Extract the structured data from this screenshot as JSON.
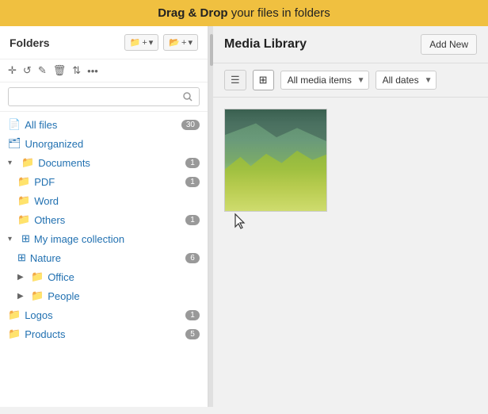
{
  "banner": {
    "text_bold": "Drag & Drop",
    "text_rest": " your files in folders"
  },
  "left_panel": {
    "folders_label": "Folders",
    "btn_new_folder": "+ ▾",
    "btn_new_subfolder": "+ ▾",
    "toolbar_icons": [
      "✛",
      "↺",
      "✎",
      "🗑",
      "↑↓",
      "…"
    ],
    "search_placeholder": "",
    "tree": [
      {
        "id": "all-files",
        "label": "All files",
        "icon": "file",
        "indent": 0,
        "badge": "30",
        "chevron": ""
      },
      {
        "id": "unorganized",
        "label": "Unorganized",
        "icon": "folder-outline",
        "indent": 0,
        "badge": "",
        "chevron": ""
      },
      {
        "id": "documents",
        "label": "Documents",
        "icon": "folder",
        "indent": 0,
        "badge": "1",
        "chevron": "▾",
        "expanded": true
      },
      {
        "id": "pdf",
        "label": "PDF",
        "icon": "folder",
        "indent": 1,
        "badge": "1",
        "chevron": ""
      },
      {
        "id": "word",
        "label": "Word",
        "icon": "folder",
        "indent": 1,
        "badge": "",
        "chevron": ""
      },
      {
        "id": "others",
        "label": "Others",
        "icon": "folder",
        "indent": 1,
        "badge": "1",
        "chevron": ""
      },
      {
        "id": "my-image-collection",
        "label": "My image collection",
        "icon": "grid",
        "indent": 0,
        "badge": "",
        "chevron": "▾",
        "expanded": true
      },
      {
        "id": "nature",
        "label": "Nature",
        "icon": "grid",
        "indent": 1,
        "badge": "6",
        "chevron": ""
      },
      {
        "id": "office",
        "label": "Office",
        "icon": "folder",
        "indent": 1,
        "badge": "",
        "chevron": "▶",
        "expanded": false
      },
      {
        "id": "people",
        "label": "People",
        "icon": "folder",
        "indent": 1,
        "badge": "",
        "chevron": "▶",
        "expanded": false
      },
      {
        "id": "logos",
        "label": "Logos",
        "icon": "folder-outline",
        "indent": 0,
        "badge": "1",
        "chevron": ""
      },
      {
        "id": "products",
        "label": "Products",
        "icon": "folder-outline",
        "indent": 0,
        "badge": "5",
        "chevron": ""
      }
    ]
  },
  "right_panel": {
    "title": "Media Library",
    "add_new_btn": "Add New",
    "filter_media": "All media items",
    "filter_date": "All dates",
    "filter_media_icon": "▼",
    "filter_date_icon": "▼"
  }
}
